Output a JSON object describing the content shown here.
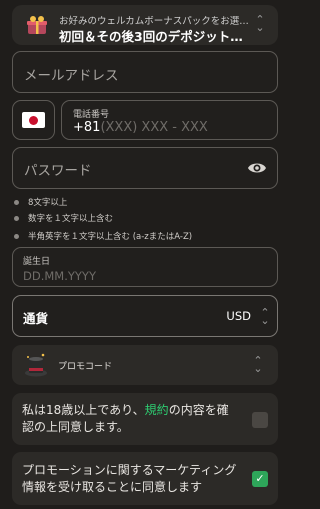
{
  "bonus": {
    "subtitle": "お好みのウェルカムボーナスパックをお選び…",
    "title": "初回＆その後3回のデポジットに…"
  },
  "email": {
    "placeholder": "メールアドレス"
  },
  "phone": {
    "label": "電話番号",
    "country_code": "+81",
    "placeholder": "(XXX) XXX - XXX",
    "flag": "japan-flag"
  },
  "password": {
    "placeholder": "パスワード",
    "requirements": [
      "8文字以上",
      "数字を１文字以上含む",
      "半角英字を１文字以上含む (a-zまたはA-Z)"
    ]
  },
  "dob": {
    "label": "誕生日",
    "placeholder": "DD.MM.YYYY"
  },
  "currency": {
    "label": "通貨",
    "value": "USD"
  },
  "promo": {
    "label": "プロモコード"
  },
  "consent_age": {
    "text_before": "私は18歳以上であり、",
    "link": "規約",
    "text_after": "の内容を確認の上同意します。",
    "checked": false
  },
  "consent_marketing": {
    "text": "プロモーションに関するマーケティング情報を受け取ることに同意します",
    "checked": true
  },
  "colors": {
    "accent": "#2ecc71",
    "checkbox_on": "#2ea65a",
    "background": "#1f1d1b"
  }
}
